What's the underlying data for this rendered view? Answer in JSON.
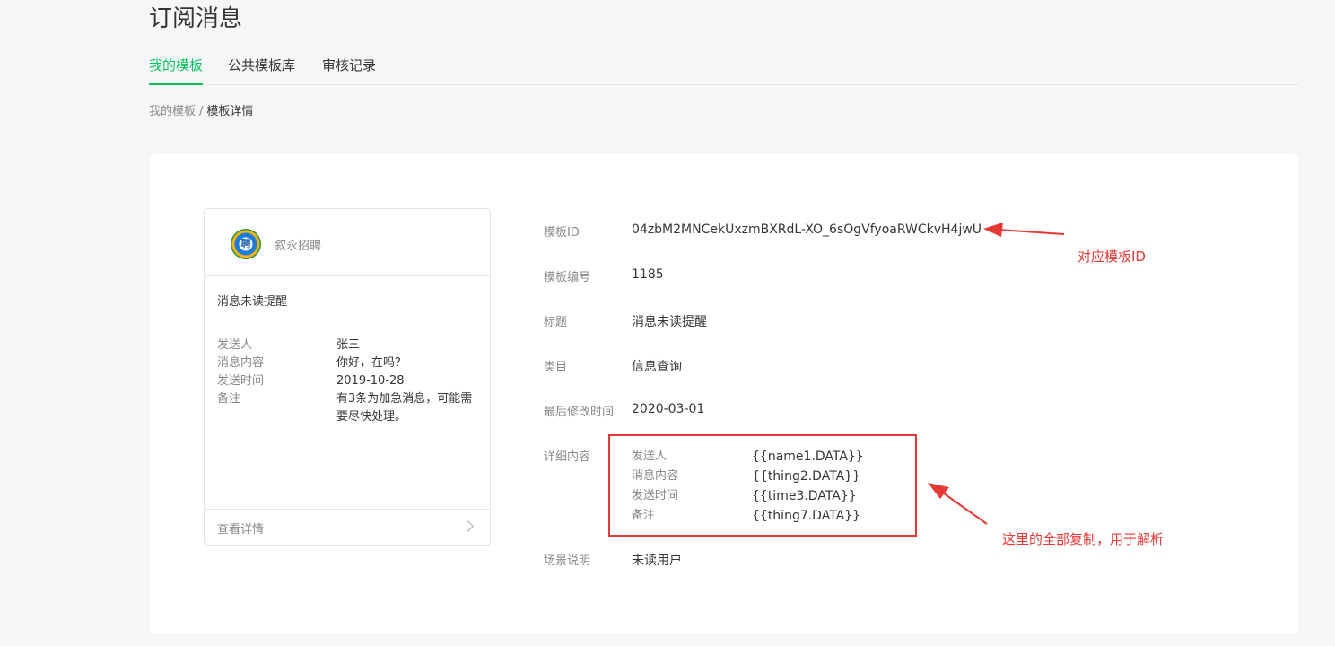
{
  "page": {
    "title": "订阅消息"
  },
  "tabs": [
    {
      "label": "我的模板",
      "active": true
    },
    {
      "label": "公共模板库",
      "active": false
    },
    {
      "label": "审核记录",
      "active": false
    }
  ],
  "breadcrumb": {
    "parent": "我的模板",
    "separator": "/",
    "current": "模板详情"
  },
  "preview_card": {
    "account_name": "叙永招聘",
    "logo_text": "聘",
    "message_title": "消息未读提醒",
    "rows": [
      {
        "key": "发送人",
        "value": "张三"
      },
      {
        "key": "消息内容",
        "value": "你好，在吗？"
      },
      {
        "key": "发送时间",
        "value": "2019-10-28"
      },
      {
        "key": "备注",
        "value": "有3条为加急消息，可能需要尽快处理。"
      }
    ],
    "footer_label": "查看详情"
  },
  "details": {
    "template_id": {
      "label": "模板ID",
      "value": "04zbM2MNCekUxzmBXRdL-XO_6sOgVfyoaRWCkvH4jwU"
    },
    "template_number": {
      "label": "模板编号",
      "value": "1185"
    },
    "title": {
      "label": "标题",
      "value": "消息未读提醒"
    },
    "category": {
      "label": "类目",
      "value": "信息查询"
    },
    "last_modified": {
      "label": "最后修改时间",
      "value": "2020-03-01"
    },
    "content": {
      "label": "详细内容",
      "rows": [
        {
          "key": "发送人",
          "value": "{{name1.DATA}}"
        },
        {
          "key": "消息内容",
          "value": "{{thing2.DATA}}"
        },
        {
          "key": "发送时间",
          "value": "{{time3.DATA}}"
        },
        {
          "key": "备注",
          "value": "{{thing7.DATA}}"
        }
      ]
    },
    "scene": {
      "label": "场景说明",
      "value": "未读用户"
    }
  },
  "annotations": {
    "template_id_note": "对应模板ID",
    "content_note": "这里的全部复制，用于解析",
    "color": "#e53935"
  },
  "colors": {
    "accent": "#07c160"
  }
}
